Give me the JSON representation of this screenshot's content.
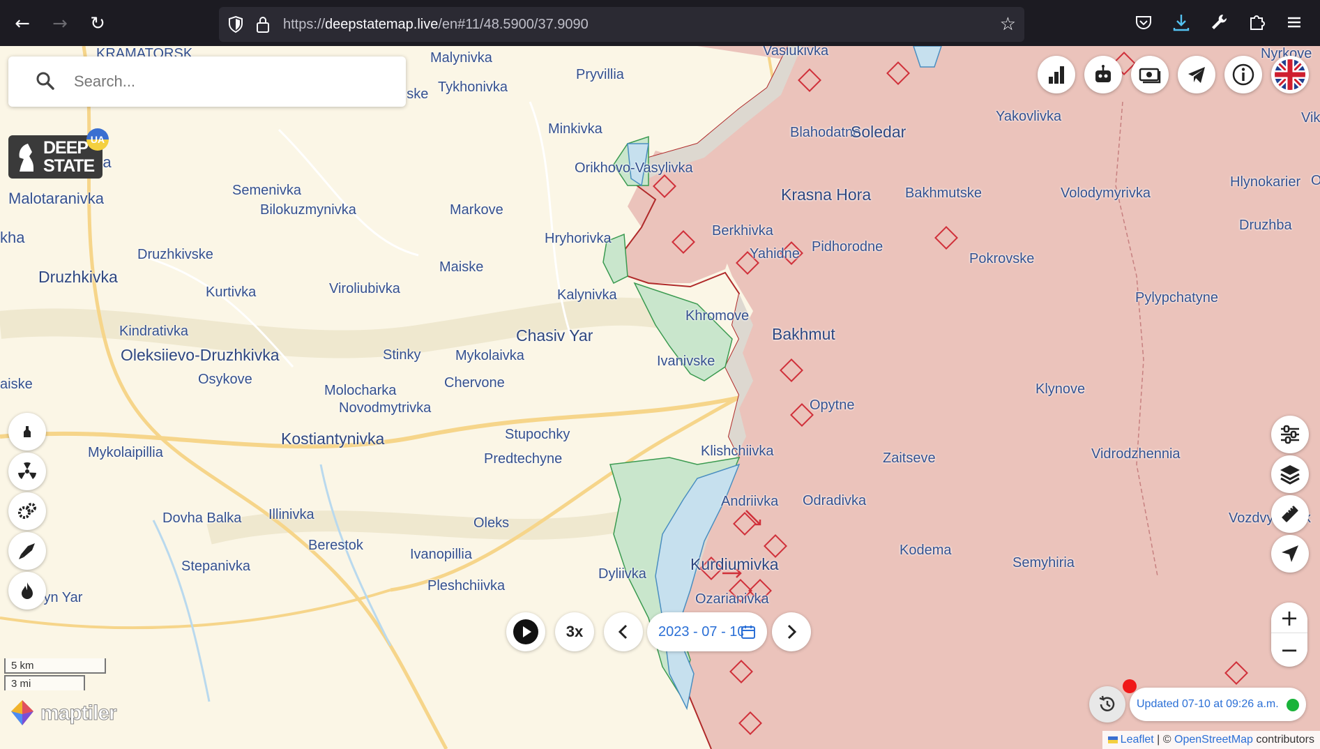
{
  "browser": {
    "url_prefix": "https://",
    "url_domain": "deepstatemap.live",
    "url_rest": "/en#11/48.5900/37.9090",
    "back_icon": "arrow-left-icon",
    "forward_icon": "arrow-right-icon",
    "reload_icon": "reload-icon",
    "toolbar_icons": [
      "pocket-icon",
      "download-icon",
      "wrench-icon",
      "extensions-icon",
      "menu-icon"
    ]
  },
  "search": {
    "placeholder": "Search..."
  },
  "logo": {
    "line1": "DEEP",
    "line2": "STATE",
    "badge": "UA"
  },
  "places": [
    {
      "name": "KRAMATORSK",
      "cls": ""
    },
    {
      "name": "Malynivka",
      "cls": ""
    },
    {
      "name": "Pryvillia",
      "cls": ""
    },
    {
      "name": "Vasiukivka",
      "cls": ""
    },
    {
      "name": "Vasiutynske",
      "cls": ""
    },
    {
      "name": "Tykhonivka",
      "cls": ""
    },
    {
      "name": "Minkivka",
      "cls": ""
    },
    {
      "name": "Yakovlivka",
      "cls": ""
    },
    {
      "name": "Blahodatne",
      "cls": ""
    },
    {
      "name": "Soledar",
      "cls": "big"
    },
    {
      "name": "Krasnotorka",
      "cls": "town"
    },
    {
      "name": "Orikhovo-Vasylivka",
      "cls": ""
    },
    {
      "name": "Semenivka",
      "cls": ""
    },
    {
      "name": "Krasna Hora",
      "cls": "big"
    },
    {
      "name": "Bakhmutske",
      "cls": ""
    },
    {
      "name": "Volodymyrivka",
      "cls": ""
    },
    {
      "name": "Hlynokarier",
      "cls": ""
    },
    {
      "name": "Malotaranivka",
      "cls": "town"
    },
    {
      "name": "Bilokuzmynivka",
      "cls": ""
    },
    {
      "name": "Markove",
      "cls": ""
    },
    {
      "name": "Berkhivka",
      "cls": ""
    },
    {
      "name": "Druzhba",
      "cls": ""
    },
    {
      "name": "kha",
      "cls": "town"
    },
    {
      "name": "Hryhorivka",
      "cls": ""
    },
    {
      "name": "Pidhorodne",
      "cls": ""
    },
    {
      "name": "Yahidne",
      "cls": ""
    },
    {
      "name": "Druzhkivske",
      "cls": ""
    },
    {
      "name": "Pokrovske",
      "cls": ""
    },
    {
      "name": "Maiske",
      "cls": ""
    },
    {
      "name": "Druzhkivka",
      "cls": "big"
    },
    {
      "name": "Kurtivka",
      "cls": ""
    },
    {
      "name": "Viroliubivka",
      "cls": ""
    },
    {
      "name": "Kalynivka",
      "cls": ""
    },
    {
      "name": "Pylypchatyne",
      "cls": ""
    },
    {
      "name": "Khromove",
      "cls": ""
    },
    {
      "name": "Kindrativka",
      "cls": ""
    },
    {
      "name": "Bakhmut",
      "cls": "big"
    },
    {
      "name": "Chasiv Yar",
      "cls": "big"
    },
    {
      "name": "Oleksiievo-Druzhkivka",
      "cls": "big"
    },
    {
      "name": "Stinky",
      "cls": ""
    },
    {
      "name": "Mykolaivka",
      "cls": ""
    },
    {
      "name": "Ivanivske",
      "cls": ""
    },
    {
      "name": "Osykove",
      "cls": ""
    },
    {
      "name": "aiske",
      "cls": ""
    },
    {
      "name": "Chervone",
      "cls": ""
    },
    {
      "name": "Klynove",
      "cls": ""
    },
    {
      "name": "Molocharka",
      "cls": ""
    },
    {
      "name": "Opytne",
      "cls": ""
    },
    {
      "name": "Novodmytrivka",
      "cls": ""
    },
    {
      "name": "Stupochky",
      "cls": ""
    },
    {
      "name": "Kostiantynivka",
      "cls": "big"
    },
    {
      "name": "Klishchiivka",
      "cls": ""
    },
    {
      "name": "Mykolaipillia",
      "cls": ""
    },
    {
      "name": "Vidrodzhennia",
      "cls": ""
    },
    {
      "name": "Predtechyne",
      "cls": ""
    },
    {
      "name": "Zaitseve",
      "cls": ""
    },
    {
      "name": "Andriivka",
      "cls": ""
    },
    {
      "name": "Odradivka",
      "cls": ""
    },
    {
      "name": "Illinivka",
      "cls": ""
    },
    {
      "name": "Dovha Balka",
      "cls": ""
    },
    {
      "name": "Oleks",
      "cls": ""
    },
    {
      "name": "Vozdvyzhenk",
      "cls": ""
    },
    {
      "name": "Berestok",
      "cls": ""
    },
    {
      "name": "Kodema",
      "cls": ""
    },
    {
      "name": "Ivanopillia",
      "cls": ""
    },
    {
      "name": "Stepanivka",
      "cls": ""
    },
    {
      "name": "Kurdiumivka",
      "cls": "big"
    },
    {
      "name": "Semyhiria",
      "cls": ""
    },
    {
      "name": "Dyliivka",
      "cls": ""
    },
    {
      "name": "Pleshchiivka",
      "cls": ""
    },
    {
      "name": "Kusyn Yar",
      "cls": ""
    },
    {
      "name": "Ozarianivka",
      "cls": ""
    },
    {
      "name": "Nyrkove",
      "cls": ""
    },
    {
      "name": "Vik",
      "cls": ""
    },
    {
      "name": "O",
      "cls": ""
    }
  ],
  "top_buttons": [
    "bar-chart-icon",
    "robot-icon",
    "money-icon",
    "telegram-icon",
    "info-icon",
    "uk-flag-icon"
  ],
  "left_buttons": [
    "monument-icon",
    "radiation-icon",
    "gears-icon",
    "rocket-icon",
    "fire-icon"
  ],
  "right_buttons": [
    "sliders-icon",
    "layers-icon",
    "ruler-icon",
    "locate-icon"
  ],
  "zoom": {
    "in": "+",
    "out": "−"
  },
  "playback": {
    "speed": "3x",
    "date": "2023 - 07 - 10"
  },
  "updated": {
    "text": "Updated 07-10 at 09:26 a.m."
  },
  "scale": {
    "km": "5 km",
    "mi": "3 mi"
  },
  "maptiler": {
    "text": "maptiler"
  },
  "attribution": {
    "leaflet": "Leaflet",
    "sep": " | © ",
    "osm": "OpenStreetMap",
    "suffix": " contributors"
  },
  "colors": {
    "occupied": "#ebc3bb",
    "front_line": "#b02a2a",
    "liberated": "#c9e6cc",
    "water": "#c6e0ee",
    "map_bg": "#fbf6e6"
  }
}
